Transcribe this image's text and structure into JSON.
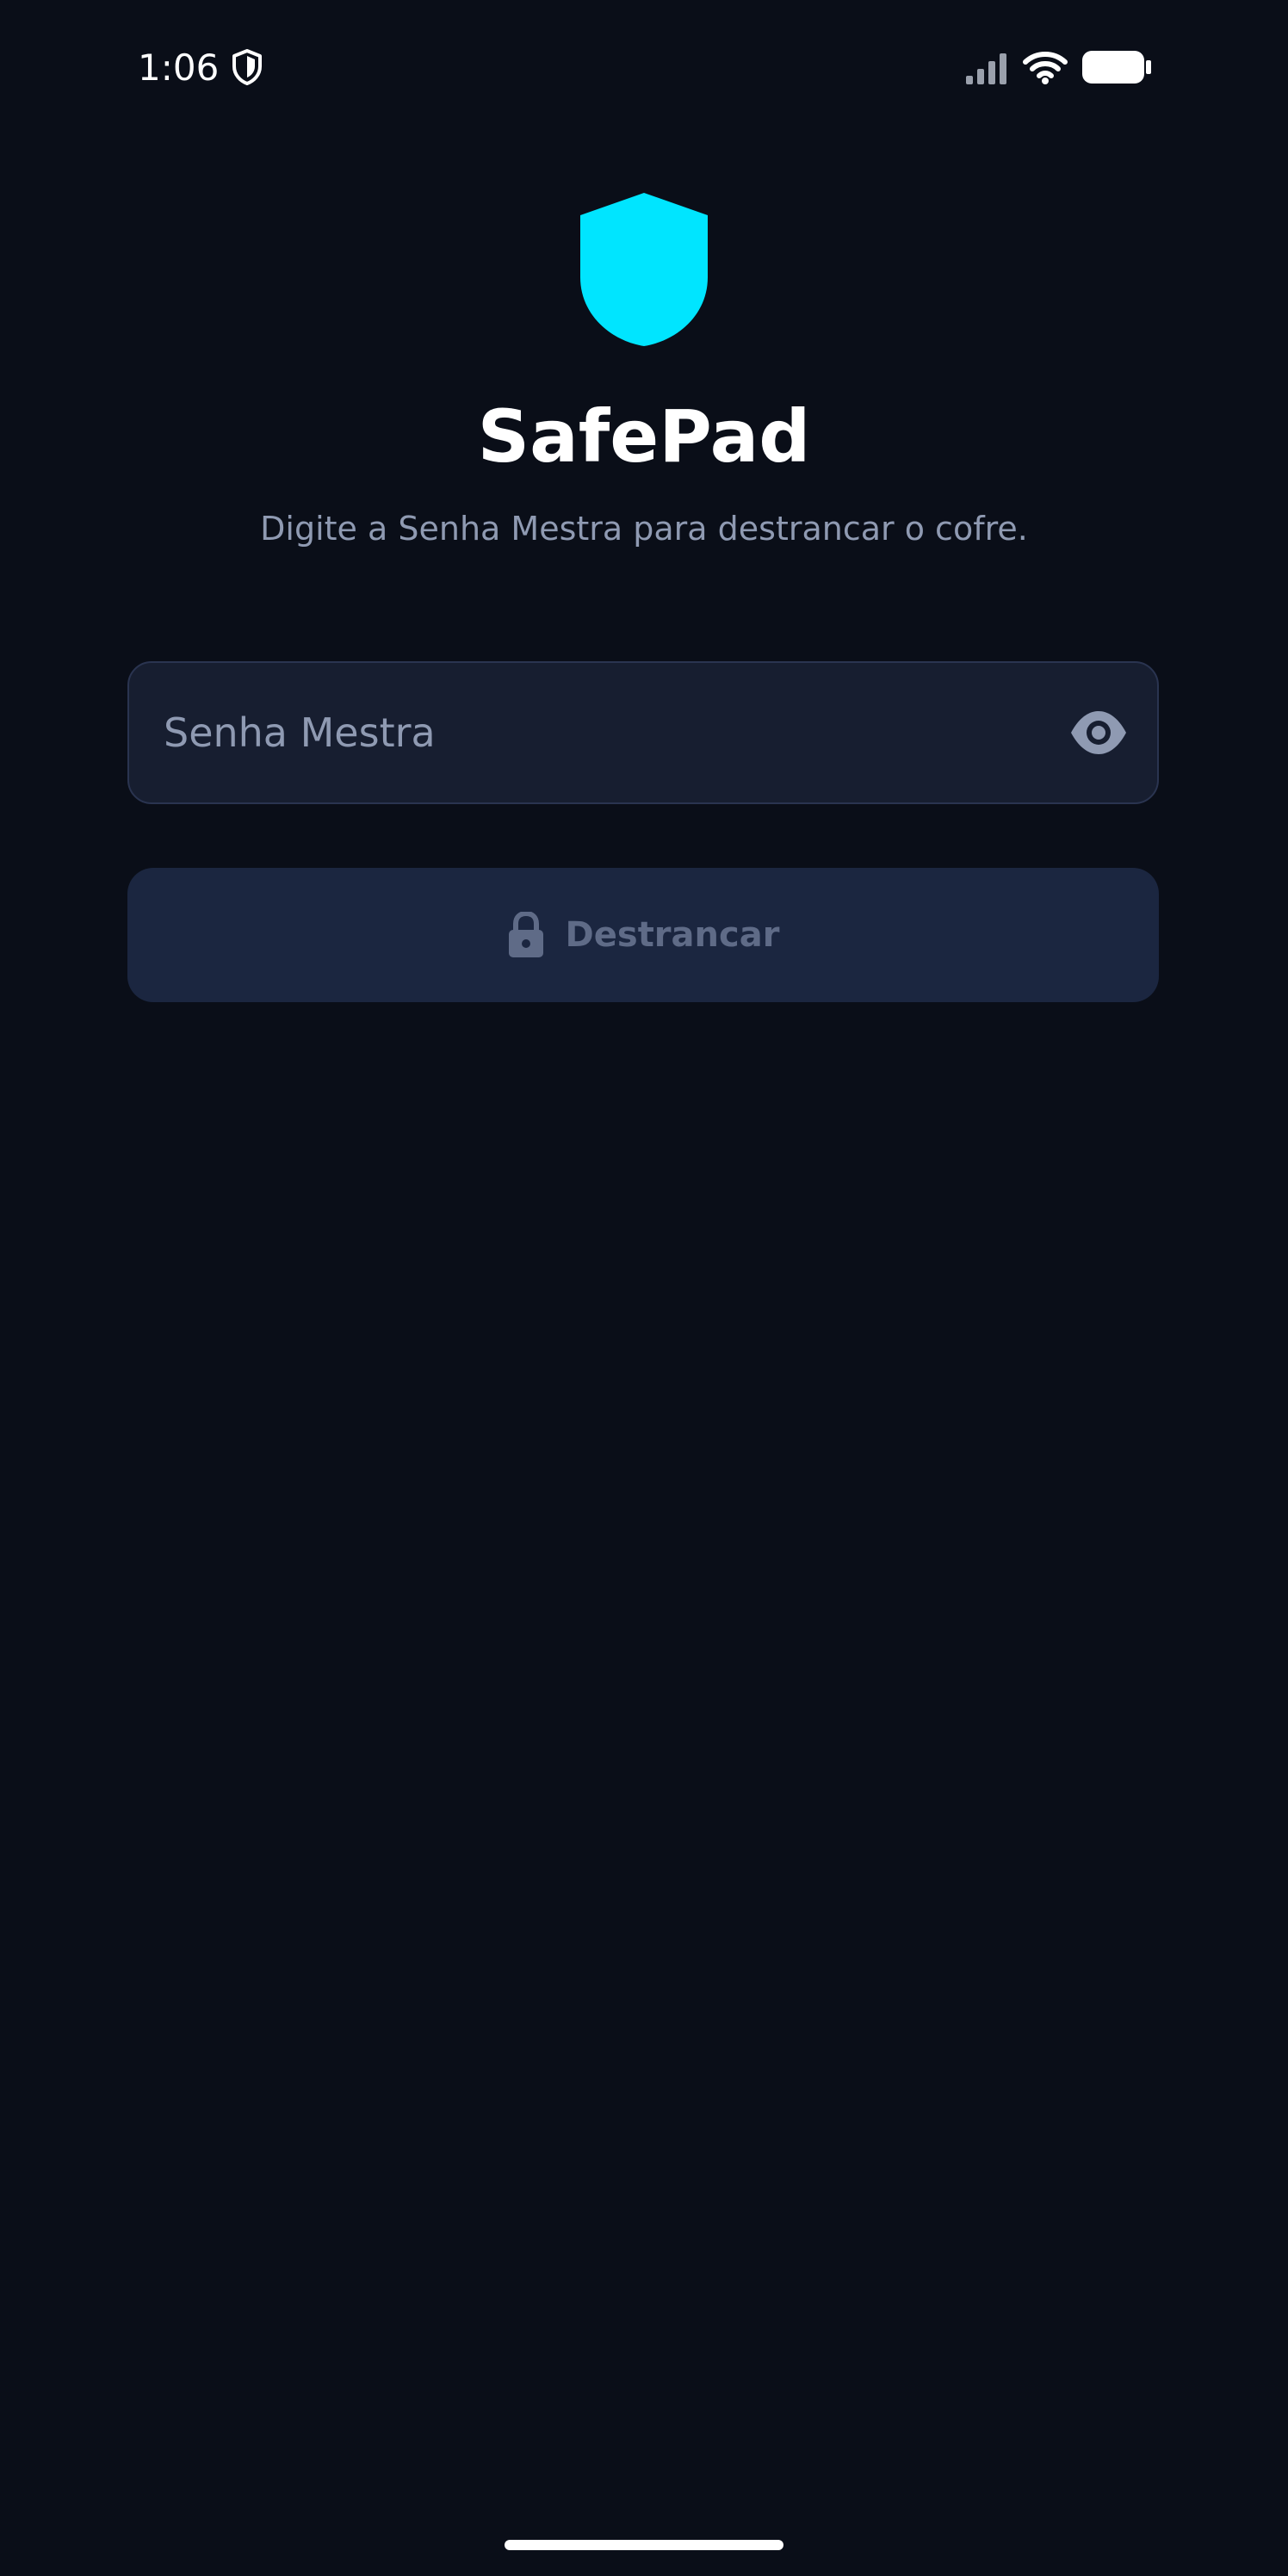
{
  "status_bar": {
    "time": "1:06",
    "icons": [
      "shield-icon",
      "signal-icon",
      "wifi-icon",
      "battery-icon"
    ]
  },
  "header": {
    "logo_icon": "shield-icon",
    "title": "SafePad",
    "subtitle": "Digite a Senha Mestra para destrancar o cofre."
  },
  "form": {
    "password_placeholder": "Senha Mestra",
    "password_value": "",
    "toggle_visibility_icon": "eye-icon",
    "unlock_label": "Destrancar",
    "unlock_icon": "lock-icon"
  },
  "colors": {
    "background": "#0a0e18",
    "accent": "#00e5ff",
    "field_background": "#171e30",
    "button_background": "#1b2640",
    "button_text": "#5f6b87",
    "muted_text": "#8f9ab2"
  }
}
